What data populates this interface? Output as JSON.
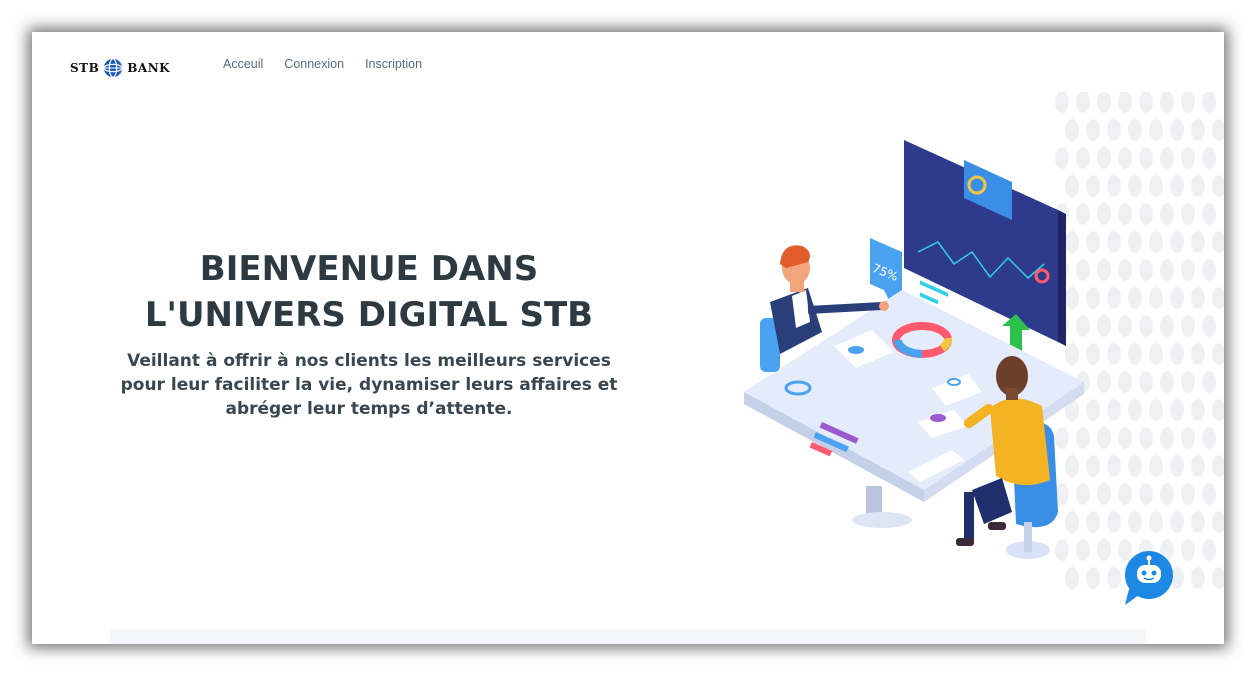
{
  "brand": {
    "left": "STB",
    "right": "BANK",
    "icon": "globe-logo-icon",
    "color": "#1e5bb8"
  },
  "nav": {
    "items": [
      {
        "label": "Acceuil"
      },
      {
        "label": "Connexion"
      },
      {
        "label": "Inscription"
      }
    ]
  },
  "hero": {
    "title_line1": "BIENVENUE DANS",
    "title_line2": "L'UNIVERS DIGITAL STB",
    "subtitle": "Veillant à offrir à nos clients les meilleurs services pour leur faciliter la vie, dynamiser leurs affaires et abréger leur temps d’attente."
  },
  "illustration": {
    "badge_text": "75%",
    "icon": "meeting-illustration",
    "colors": {
      "board": "#2e3a8c",
      "accent_cyan": "#2fd1e6",
      "accent_red": "#ff5a6e",
      "arrow_green": "#2bc14a",
      "table": "#e4ebfa"
    }
  },
  "chatbot": {
    "icon": "chatbot-icon",
    "color": "#1e88e5"
  }
}
